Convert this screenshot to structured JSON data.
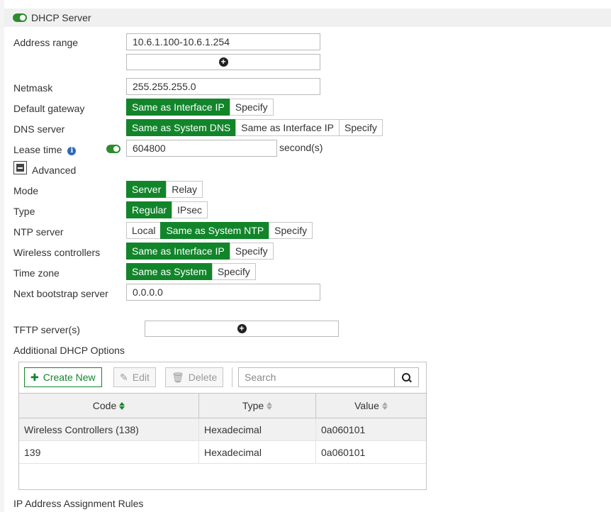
{
  "section": {
    "title": "DHCP Server",
    "enabled": true
  },
  "address_range": {
    "label": "Address range",
    "value": "10.6.1.100-10.6.1.254"
  },
  "netmask": {
    "label": "Netmask",
    "value": "255.255.255.0"
  },
  "default_gateway": {
    "label": "Default gateway",
    "options": [
      "Same as Interface IP",
      "Specify"
    ],
    "selected": "Same as Interface IP"
  },
  "dns_server": {
    "label": "DNS server",
    "options": [
      "Same as System DNS",
      "Same as Interface IP",
      "Specify"
    ],
    "selected": "Same as System DNS"
  },
  "lease_time": {
    "label": "Lease time",
    "value": "604800",
    "unit": "second(s)",
    "enabled": true
  },
  "advanced": {
    "label": "Advanced",
    "expanded": true
  },
  "mode": {
    "label": "Mode",
    "options": [
      "Server",
      "Relay"
    ],
    "selected": "Server"
  },
  "type": {
    "label": "Type",
    "options": [
      "Regular",
      "IPsec"
    ],
    "selected": "Regular"
  },
  "ntp_server": {
    "label": "NTP server",
    "options": [
      "Local",
      "Same as System NTP",
      "Specify"
    ],
    "selected": "Same as System NTP"
  },
  "wireless_controllers": {
    "label": "Wireless controllers",
    "options": [
      "Same as Interface IP",
      "Specify"
    ],
    "selected": "Same as Interface IP"
  },
  "time_zone": {
    "label": "Time zone",
    "options": [
      "Same as System",
      "Specify"
    ],
    "selected": "Same as System"
  },
  "next_bootstrap": {
    "label": "Next bootstrap server",
    "value": "0.0.0.0"
  },
  "tftp": {
    "label": "TFTP server(s)"
  },
  "dhcp_options": {
    "label": "Additional DHCP Options",
    "toolbar": {
      "create": "Create New",
      "edit": "Edit",
      "delete": "Delete",
      "search_placeholder": "Search"
    },
    "columns": [
      "Code",
      "Type",
      "Value"
    ],
    "sorted_column": "Code",
    "rows": [
      {
        "code": "Wireless Controllers (138)",
        "type": "Hexadecimal",
        "value": "0a060101",
        "selected": true
      },
      {
        "code": "139",
        "type": "Hexadecimal",
        "value": "0a060101",
        "selected": false
      }
    ]
  },
  "ip_rules": {
    "label": "IP Address Assignment Rules"
  },
  "colors": {
    "active_green": "#12852b",
    "info_blue": "#2a6ab3",
    "border": "#b9b9b9"
  },
  "icons": [
    "toggle-on-icon",
    "plus-circle-icon",
    "info-icon",
    "collapse-icon",
    "plus-icon",
    "pencil-icon",
    "trash-icon",
    "search-icon",
    "sort-icon"
  ]
}
